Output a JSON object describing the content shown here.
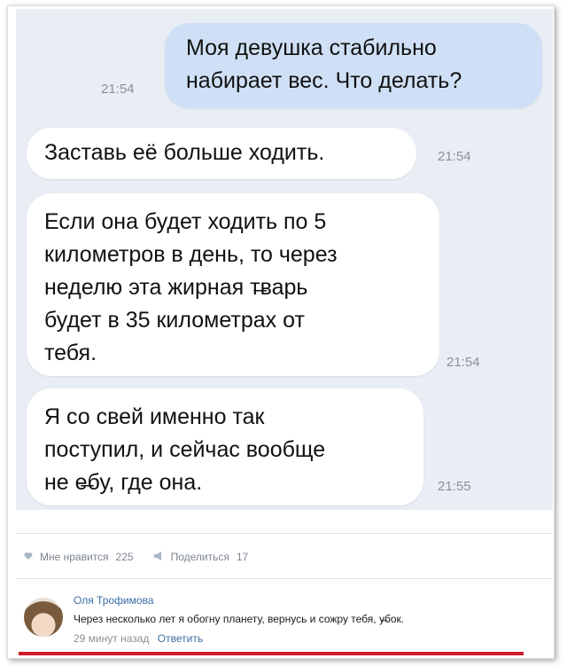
{
  "messages": [
    {
      "lines": [
        "Моя девушка стабильно",
        "набирает вес. Что делать?"
      ],
      "time": "21:54"
    },
    {
      "lines": [
        "Заставь её больше ходить."
      ],
      "time": "21:54"
    },
    {
      "lines": [
        "Если она будет ходить по 5",
        "километров в день, то через",
        "неделю эта жирная т̶варь",
        "будет в 35 километрах от",
        "тебя."
      ],
      "time": "21:54"
    },
    {
      "lines": [
        "Я со свей именно так",
        "поступил, и сейчас вообще",
        "не е̶бу, где она."
      ],
      "time": "21:55"
    }
  ],
  "actions": {
    "like_label": "Мне нравится",
    "like_count": "225",
    "share_label": "Поделиться",
    "share_count": "17"
  },
  "comment": {
    "author": "Оля Трофимова",
    "text": "Через несколько лет я обогну планету, вернусь и сожру тебя, у̶̶бок.",
    "time": "29 минут назад",
    "reply_label": "Ответить"
  },
  "colors": {
    "chat_background": "#e9eef5",
    "outgoing_bubble": "#cfe0f6",
    "incoming_bubble": "#ffffff",
    "link": "#3b6ea5",
    "red_line": "#d11a2a"
  }
}
